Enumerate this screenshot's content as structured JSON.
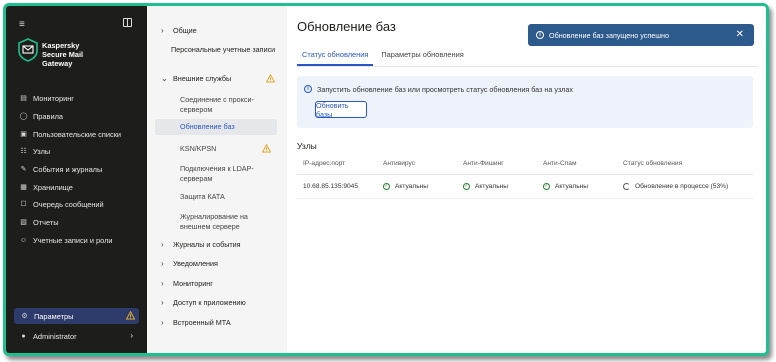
{
  "brand": {
    "line1": "Kaspersky",
    "line2": "Secure Mail",
    "line3": "Gateway",
    "accent": "#1fbf8f"
  },
  "sidebar": {
    "menu_icon": "menu-icon",
    "items": [
      {
        "label": "Мониторинг",
        "icon": "monitoring-icon"
      },
      {
        "label": "Правила",
        "icon": "rules-icon"
      },
      {
        "label": "Пользовательские списки",
        "icon": "lists-icon"
      },
      {
        "label": "Узлы",
        "icon": "nodes-icon"
      },
      {
        "label": "События и журналы",
        "icon": "events-icon"
      },
      {
        "label": "Хранилище",
        "icon": "storage-icon"
      },
      {
        "label": "Очередь сообщений",
        "icon": "queue-icon"
      },
      {
        "label": "Отчеты",
        "icon": "reports-icon"
      },
      {
        "label": "Учетные записи и роли",
        "icon": "accounts-icon"
      }
    ],
    "settings_label": "Параметры",
    "admin_label": "Administrator"
  },
  "tree": {
    "general": "Общие",
    "personal_accounts": "Персональные учетные записи",
    "external_services": "Внешние службы",
    "proxy": "Соединение с прокси-сервером",
    "db_update": "Обновление баз",
    "ksn": "KSN/KPSN",
    "ldap": "Подключения к LDAP-серверам",
    "kata": "Защита КАТА",
    "ext_logging": "Журналирование на внешнем сервере",
    "logs_events": "Журналы и события",
    "notifications": "Уведомления",
    "monitoring": "Мониторинг",
    "app_access": "Доступ к приложению",
    "builtin_mta": "Встроенный МТА"
  },
  "main": {
    "title": "Обновление баз",
    "tabs": [
      {
        "label": "Статус обновления"
      },
      {
        "label": "Параметры обновления"
      }
    ],
    "info_text": "Запустить обновление баз или просмотреть статус обновления баз на узлах",
    "update_button": "Обновить базы",
    "nodes_title": "Узлы",
    "table": {
      "headers": [
        "IP-адрес:порт",
        "Антивирус",
        "Анти-Фишинг",
        "Анти-Спам",
        "Статус обновления"
      ],
      "row": {
        "ip": "10.68.85.135:9045",
        "antivirus": "Актуальны",
        "antiphishing": "Актуальны",
        "antispam": "Актуальны",
        "status": "Обновление в процессе (53%)"
      }
    }
  },
  "toast": {
    "text": "Обновление баз запущено успешно"
  }
}
